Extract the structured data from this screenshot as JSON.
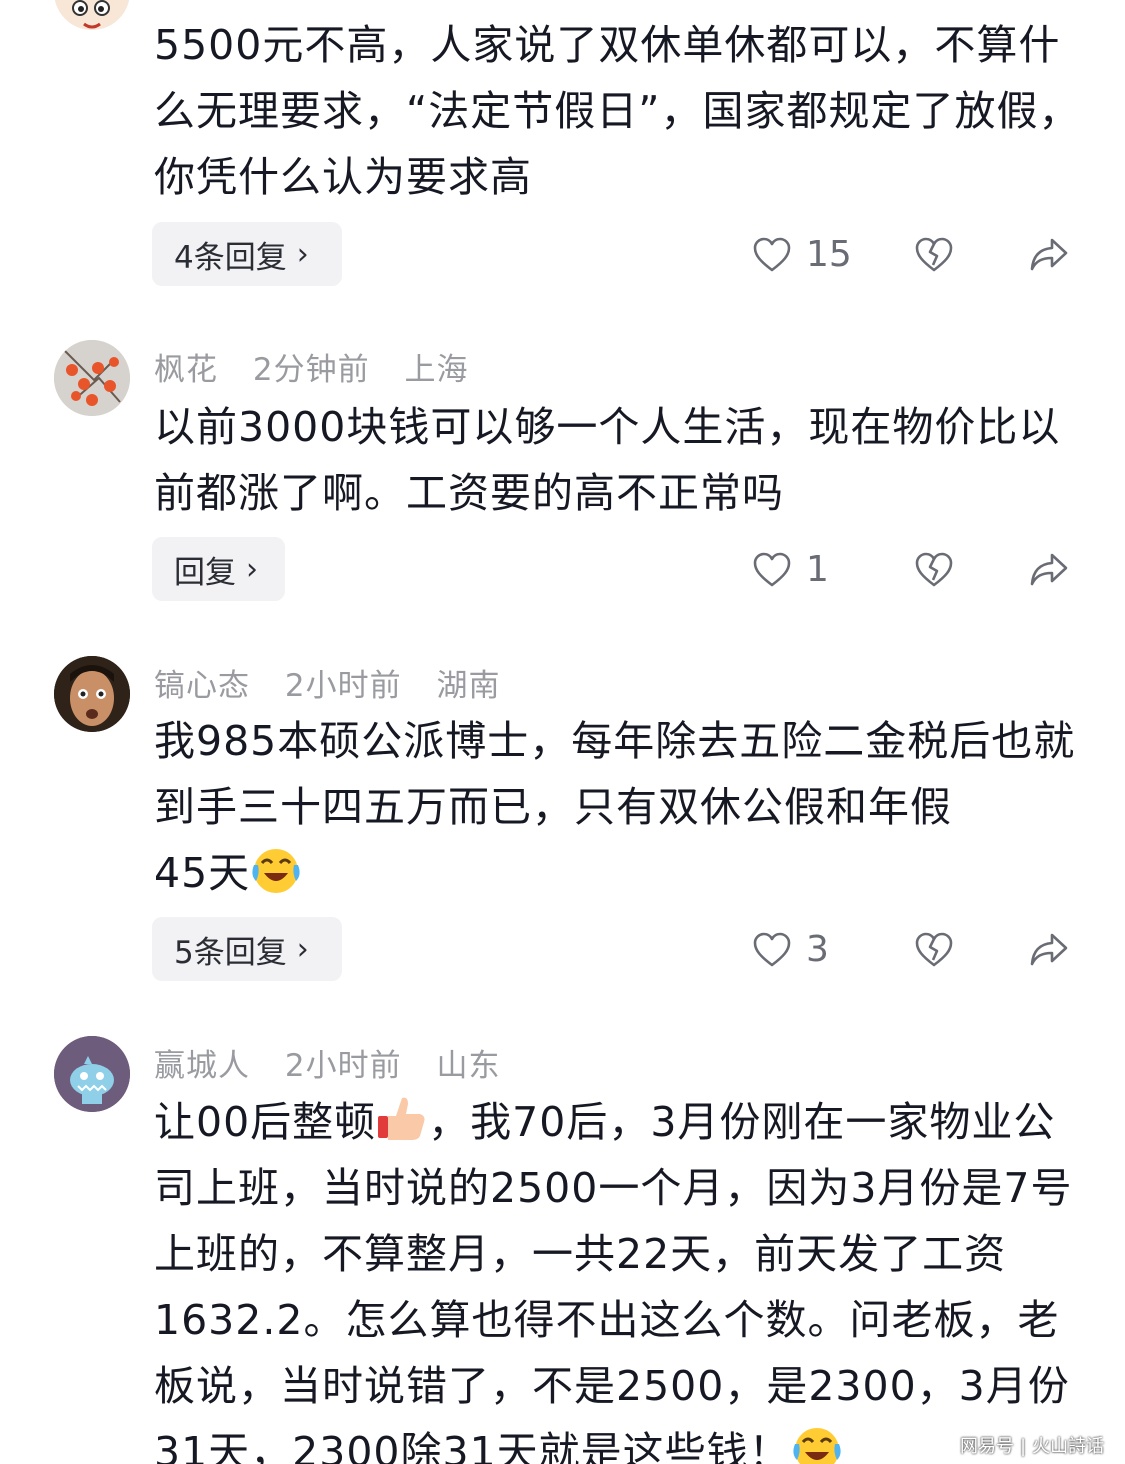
{
  "comments": [
    {
      "text": "5500元不高，人家说了双休单休都可以，不算什么无理要求，“法定节假日”，国家都规定了放假，你凭什么认为要求高",
      "reply_label": "4条回复",
      "likes": "15"
    },
    {
      "username": "枫花",
      "time": "2分钟前",
      "location": "上海",
      "text": "以前3000块钱可以够一个人生活，现在物价比以前都涨了啊。工资要的高不正常吗",
      "reply_label": "回复",
      "likes": "1"
    },
    {
      "username": "镐心态",
      "time": "2小时前",
      "location": "湖南",
      "text_line1": "我985本硕公派博士，每年除去五险二金税后也就到手三十四五万而已，只有双休公假和年假",
      "text_line2": "45天",
      "reply_label": "5条回复",
      "likes": "3"
    },
    {
      "username": "赢城人",
      "time": "2小时前",
      "location": "山东",
      "text_part1": "让00后整顿",
      "text_part2": "，我70后，3月份刚在一家物业公司上班，当时说的2500一个月，因为3月份是7号上班的，不算整月，一共22天，前天发了工资1632.2。怎么算也得不出这么个数。问老板，老板说，当时说错了，不是2500，是2300，3月份31天，2300除31天就是这些钱！"
    }
  ],
  "icons": {
    "like": "heart-outline-icon",
    "dislike": "broken-heart-icon",
    "share": "share-arrow-icon",
    "chevron": "chevron-right-icon",
    "emoji_laugh": "laughing-crying-emoji",
    "emoji_thumb": "thumbs-up-emoji"
  },
  "chevron_glyph": "›",
  "watermark": {
    "left": "网易号",
    "right": "火山詩话"
  }
}
